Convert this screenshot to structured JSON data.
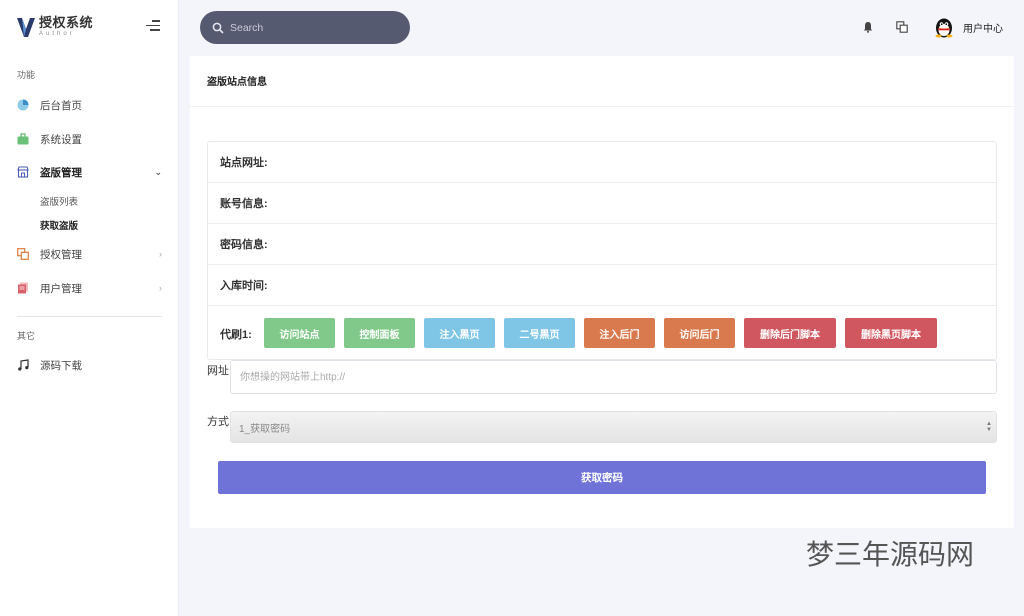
{
  "sidebar": {
    "logo_title": "授权系统",
    "logo_subtitle": "Author",
    "section_main": "功能",
    "section_other": "其它",
    "items": {
      "dashboard": "后台首页",
      "settings": "系统设置",
      "piracy": "盗版管理",
      "auth": "授权管理",
      "users": "用户管理",
      "download": "源码下载"
    },
    "piracy_sub": {
      "list": "盗版列表",
      "get": "获取盗版"
    }
  },
  "topbar": {
    "search_placeholder": "Search",
    "user_label": "用户中心"
  },
  "card": {
    "title": "盗版站点信息",
    "rows": {
      "site_url": "站点网址:",
      "account": "账号信息:",
      "password": "密码信息:",
      "time": "入库时间:",
      "code": "代刷1:"
    },
    "buttons": {
      "visit_site": "访问站点",
      "control_panel": "控制面板",
      "inject_black": "注入黑页",
      "second_black": "二号黑页",
      "inject_backdoor": "注入后门",
      "visit_backdoor": "访问后门",
      "del_backdoor": "删除后门脚本",
      "del_black": "删除黑页脚本"
    },
    "url_label": "网址",
    "url_placeholder": "你想操的网站带上http://",
    "method_label": "方式",
    "method_selected": "1_获取密码",
    "submit_label": "获取密码"
  },
  "watermark": "梦三年源码网",
  "colors": {
    "accent": "#6f73d8",
    "search_bg": "#565a71",
    "green": "#81c98b",
    "blue": "#7fc6e6",
    "orange": "#d97a4e",
    "red": "#d0575f"
  }
}
